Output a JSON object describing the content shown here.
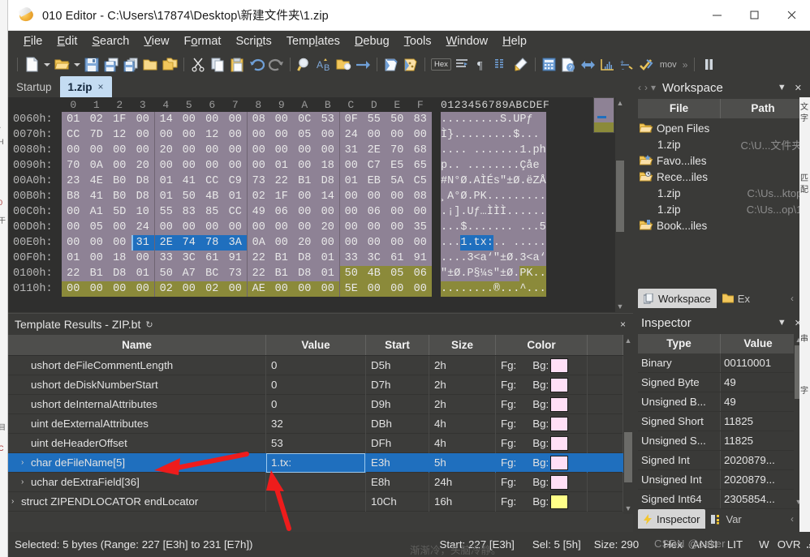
{
  "window": {
    "title": "010 Editor - C:\\Users\\17874\\Desktop\\新建文件夹\\1.zip",
    "app_icon": "app-logo-icon",
    "minimize": "–",
    "maximize": "□",
    "close": "✕"
  },
  "menubar": {
    "items": [
      {
        "label": "File",
        "accel": "F"
      },
      {
        "label": "Edit",
        "accel": "E"
      },
      {
        "label": "Search",
        "accel": "S"
      },
      {
        "label": "View",
        "accel": "V"
      },
      {
        "label": "Format",
        "accel": "o"
      },
      {
        "label": "Scripts",
        "accel": "p"
      },
      {
        "label": "Templates",
        "accel": "l"
      },
      {
        "label": "Debug",
        "accel": "D"
      },
      {
        "label": "Tools",
        "accel": "T"
      },
      {
        "label": "Window",
        "accel": "W"
      },
      {
        "label": "Help",
        "accel": "H"
      }
    ]
  },
  "toolbar": {
    "hex_label": "Hex",
    "mov_label": "mov",
    "overflow_label": "»",
    "icons": [
      "new-file-icon",
      "new-file-dropdown-icon",
      "open-file-icon",
      "open-file-dropdown-icon",
      "save-icon",
      "save-as-icon",
      "save-all-icon",
      "open-folder-icon",
      "open-folder-all-icon",
      "cut-icon",
      "copy-icon",
      "paste-icon",
      "undo-icon",
      "redo-icon",
      "find-icon",
      "replace-icon",
      "find-in-files-icon",
      "goto-icon",
      "run-script-icon",
      "run-template-icon",
      "hex-mode-icon",
      "align-icon",
      "paragraph-icon",
      "columns-icon",
      "highlight-icon",
      "calculator-icon",
      "file-help-icon",
      "compare-icon",
      "histogram-icon",
      "checksum-icon",
      "check-script-icon",
      "move-icon",
      "overflow-icon",
      "pause-icon"
    ]
  },
  "tabs": {
    "items": [
      {
        "label": "Startup",
        "active": false,
        "closable": false
      },
      {
        "label": "1.zip",
        "active": true,
        "closable": true,
        "close": "×"
      }
    ]
  },
  "hex_editor": {
    "column_header": [
      "0",
      "1",
      "2",
      "3",
      "4",
      "5",
      "6",
      "7",
      "8",
      "9",
      "A",
      "B",
      "C",
      "D",
      "E",
      "F"
    ],
    "ascii_header": "0123456789ABCDEF",
    "rows": [
      {
        "addr": "0060h:",
        "bytes": [
          "01",
          "02",
          "1F",
          "00",
          "14",
          "00",
          "00",
          "00",
          "08",
          "00",
          "0C",
          "53",
          "0F",
          "55",
          "50",
          "83"
        ],
        "ascii": ".........S.UPƒ",
        "sel": [],
        "olive": []
      },
      {
        "addr": "0070h:",
        "bytes": [
          "CC",
          "7D",
          "12",
          "00",
          "00",
          "00",
          "12",
          "00",
          "00",
          "00",
          "05",
          "00",
          "24",
          "00",
          "00",
          "00"
        ],
        "ascii": "Ì}.........$...",
        "sel": [],
        "olive": []
      },
      {
        "addr": "0080h:",
        "bytes": [
          "00",
          "00",
          "00",
          "00",
          "20",
          "00",
          "00",
          "00",
          "00",
          "00",
          "00",
          "00",
          "31",
          "2E",
          "70",
          "68"
        ],
        "ascii": ".... .......1.ph",
        "sel": [],
        "olive": []
      },
      {
        "addr": "0090h:",
        "bytes": [
          "70",
          "0A",
          "00",
          "20",
          "00",
          "00",
          "00",
          "00",
          "00",
          "01",
          "00",
          "18",
          "00",
          "C7",
          "E5",
          "65"
        ],
        "ascii": "p.. ........Çåe",
        "sel": [],
        "olive": []
      },
      {
        "addr": "00A0h:",
        "bytes": [
          "23",
          "4E",
          "B0",
          "D8",
          "01",
          "41",
          "CC",
          "C9",
          "73",
          "22",
          "B1",
          "D8",
          "01",
          "EB",
          "5A",
          "C5"
        ],
        "ascii": "#N°Ø.AÌÉs\"±Ø.ëZÅ",
        "sel": [],
        "olive": []
      },
      {
        "addr": "00B0h:",
        "bytes": [
          "B8",
          "41",
          "B0",
          "D8",
          "01",
          "50",
          "4B",
          "01",
          "02",
          "1F",
          "00",
          "14",
          "00",
          "00",
          "00",
          "08"
        ],
        "ascii": "¸A°Ø.PK.........",
        "sel": [],
        "olive": []
      },
      {
        "addr": "00C0h:",
        "bytes": [
          "00",
          "A1",
          "5D",
          "10",
          "55",
          "83",
          "85",
          "CC",
          "49",
          "06",
          "00",
          "00",
          "00",
          "06",
          "00",
          "00"
        ],
        "ascii": ".¡].Uƒ…ÌÌÌ......",
        "sel": [],
        "olive": []
      },
      {
        "addr": "00D0h:",
        "bytes": [
          "00",
          "05",
          "00",
          "24",
          "00",
          "00",
          "00",
          "00",
          "00",
          "00",
          "00",
          "20",
          "00",
          "00",
          "00",
          "35"
        ],
        "ascii": "...$....... ...5",
        "sel": [],
        "olive": []
      },
      {
        "addr": "00E0h:",
        "bytes": [
          "00",
          "00",
          "00",
          "31",
          "2E",
          "74",
          "78",
          "3A",
          "0A",
          "00",
          "20",
          "00",
          "00",
          "00",
          "00",
          "00"
        ],
        "ascii": "...1.tx:.. .....",
        "sel": [
          3,
          4,
          5,
          6,
          7
        ],
        "olive": []
      },
      {
        "addr": "00F0h:",
        "bytes": [
          "01",
          "00",
          "18",
          "00",
          "33",
          "3C",
          "61",
          "91",
          "22",
          "B1",
          "D8",
          "01",
          "33",
          "3C",
          "61",
          "91"
        ],
        "ascii": "....3<a‘\"±Ø.3<a‘",
        "sel": [],
        "olive": []
      },
      {
        "addr": "0100h:",
        "bytes": [
          "22",
          "B1",
          "D8",
          "01",
          "50",
          "A7",
          "BC",
          "73",
          "22",
          "B1",
          "D8",
          "01",
          "50",
          "4B",
          "05",
          "06"
        ],
        "ascii": "\"±Ø.P§¼s\"±Ø.PK..",
        "sel": [],
        "olive": [
          12,
          13,
          14,
          15
        ]
      },
      {
        "addr": "0110h:",
        "bytes": [
          "00",
          "00",
          "00",
          "00",
          "02",
          "00",
          "02",
          "00",
          "AE",
          "00",
          "00",
          "00",
          "5E",
          "00",
          "00",
          "00"
        ],
        "ascii": "........®...^...",
        "sel": [],
        "olive": [
          0,
          1,
          2,
          3,
          4,
          5,
          6,
          7,
          8,
          9,
          10,
          11,
          12,
          13,
          14,
          15
        ]
      }
    ]
  },
  "template_results": {
    "title": "Template Results - ZIP.bt",
    "refresh_icon": "refresh-icon",
    "close_label": "×",
    "columns": [
      "Name",
      "Value",
      "Start",
      "Size",
      "Color",
      ""
    ],
    "rows": [
      {
        "name": "ushort deFileCommentLength",
        "value": "0",
        "start": "D5h",
        "size": "2h",
        "fg": "Fg:",
        "bg": "Bg:",
        "swatch": "#ffdff6",
        "expand": "",
        "indent": 1,
        "selected": false
      },
      {
        "name": "ushort deDiskNumberStart",
        "value": "0",
        "start": "D7h",
        "size": "2h",
        "fg": "Fg:",
        "bg": "Bg:",
        "swatch": "#ffdff6",
        "expand": "",
        "indent": 1,
        "selected": false
      },
      {
        "name": "ushort deInternalAttributes",
        "value": "0",
        "start": "D9h",
        "size": "2h",
        "fg": "Fg:",
        "bg": "Bg:",
        "swatch": "#ffdff6",
        "expand": "",
        "indent": 1,
        "selected": false
      },
      {
        "name": "uint deExternalAttributes",
        "value": "32",
        "start": "DBh",
        "size": "4h",
        "fg": "Fg:",
        "bg": "Bg:",
        "swatch": "#ffdff6",
        "expand": "",
        "indent": 1,
        "selected": false
      },
      {
        "name": "uint deHeaderOffset",
        "value": "53",
        "start": "DFh",
        "size": "4h",
        "fg": "Fg:",
        "bg": "Bg:",
        "swatch": "#ffdff6",
        "expand": "",
        "indent": 1,
        "selected": false
      },
      {
        "name": "char deFileName[5]",
        "value": "1.tx:",
        "start": "E3h",
        "size": "5h",
        "fg": "Fg:",
        "bg": "Bg:",
        "swatch": "#ffdff6",
        "expand": "›",
        "indent": 1,
        "selected": true
      },
      {
        "name": "uchar deExtraField[36]",
        "value": "",
        "start": "E8h",
        "size": "24h",
        "fg": "Fg:",
        "bg": "Bg:",
        "swatch": "#ffdff6",
        "expand": "›",
        "indent": 1,
        "selected": false
      },
      {
        "name": "struct ZIPENDLOCATOR endLocator",
        "value": "",
        "start": "10Ch",
        "size": "16h",
        "fg": "Fg:",
        "bg": "Bg:",
        "swatch": "#ffff88",
        "expand": "›",
        "indent": 0,
        "selected": false
      }
    ]
  },
  "workspace": {
    "title": "Workspace",
    "menu_icon": "▼",
    "close_icon": "✕",
    "columns": [
      "File",
      "Path"
    ],
    "items": [
      {
        "label": "Open Files",
        "path": "",
        "icon": "folder-open-icon",
        "child": false
      },
      {
        "label": "1.zip",
        "path": "C:\\U...文件夹\\",
        "icon": "",
        "child": true
      },
      {
        "label": "Favo...iles",
        "path": "",
        "icon": "folder-favorite-icon",
        "child": false
      },
      {
        "label": "Rece...iles",
        "path": "",
        "icon": "folder-recent-icon",
        "child": false
      },
      {
        "label": "1.zip",
        "path": "C:\\Us...ktop\\",
        "icon": "",
        "child": true
      },
      {
        "label": "1.zip",
        "path": "C:\\Us...op\\1\\",
        "icon": "",
        "child": true
      },
      {
        "label": "Book...iles",
        "path": "",
        "icon": "folder-bookmark-icon",
        "child": false
      }
    ],
    "tabs": [
      {
        "label": "Workspace",
        "icon": "workspace-icon",
        "active": true
      },
      {
        "label": "Ex",
        "icon": "explorer-icon",
        "active": false
      }
    ],
    "nav_prev": "‹",
    "nav_next": "›"
  },
  "inspector": {
    "title": "Inspector",
    "menu_icon": "▼",
    "close_icon": "✕",
    "columns": [
      "Type",
      "Value"
    ],
    "rows": [
      {
        "type": "Binary",
        "value": "00110001"
      },
      {
        "type": "Signed Byte",
        "value": "49"
      },
      {
        "type": "Unsigned B...",
        "value": "49"
      },
      {
        "type": "Signed Short",
        "value": "11825"
      },
      {
        "type": "Unsigned S...",
        "value": "11825"
      },
      {
        "type": "Signed Int",
        "value": "2020879..."
      },
      {
        "type": "Unsigned Int",
        "value": "2020879..."
      },
      {
        "type": "Signed Int64",
        "value": "2305854..."
      }
    ],
    "tabs": [
      {
        "label": "Inspector",
        "icon": "bolt-icon",
        "active": true
      },
      {
        "label": "Var",
        "icon": "variables-icon",
        "active": false
      }
    ],
    "nav_prev": "‹",
    "nav_next": "›"
  },
  "statusbar": {
    "selection": "Selected: 5 bytes (Range: 227 [E3h] to 231 [E7h])",
    "start": "Start: 227 [E3h]",
    "sel": "Sel: 5 [5h]",
    "size": "Size: 290",
    "hex": "Hex",
    "ansi": "ANSI",
    "lit": "LIT",
    "w": "W",
    "ovr": "OVR",
    "grip_icon": "resize-grip-icon"
  },
  "watermark": "CSDN @caker",
  "underlying_text": "渐渐冷，头脑冷静。",
  "annotations": [
    {
      "name": "red-arrow-filename",
      "target": "char deFileName[5]"
    },
    {
      "name": "red-arrow-extrafield",
      "target": "deExtraField value cell"
    }
  ]
}
